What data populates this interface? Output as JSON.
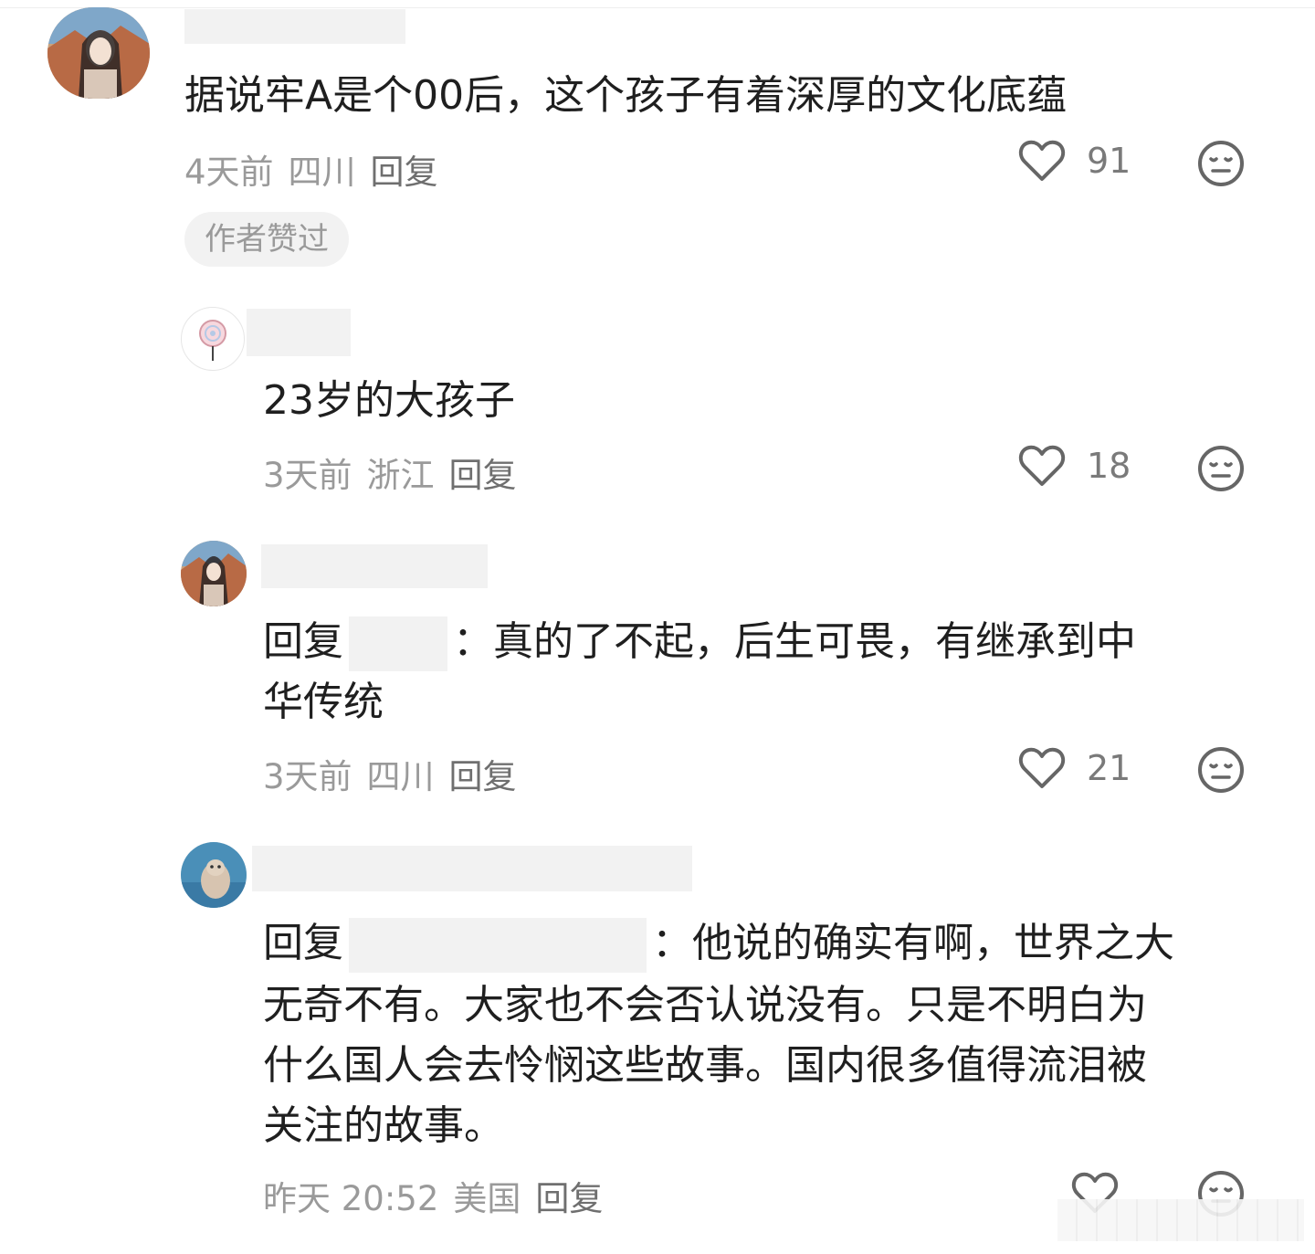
{
  "comments": [
    {
      "content": "据说牢A是个00后，这个孩子有着深厚的文化底蕴",
      "time": "4天前",
      "location": "四川",
      "reply_label": "回复",
      "likes": "91",
      "badge": "作者赞过"
    },
    {
      "content": "23岁的大孩子",
      "time": "3天前",
      "location": "浙江",
      "reply_label": "回复",
      "likes": "18"
    },
    {
      "reply_prefix": "回复",
      "content_line1": "：真的了不起，后生可畏，有继承到中",
      "content_line2": "华传统",
      "time": "3天前",
      "location": "四川",
      "reply_label": "回复",
      "likes": "21"
    },
    {
      "reply_prefix": "回复",
      "content_line1": "：他说的确实有啊，世界之大",
      "content_line2": "无奇不有。大家也不会否认说没有。只是不明白为",
      "content_line3": "什么国人会去怜悯这些故事。国内很多值得流泪被",
      "content_line4": "关注的故事。",
      "time": "昨天 20:52",
      "location": "美国",
      "reply_label": "回复"
    }
  ],
  "icons": {
    "like": "heart-outline-icon",
    "dislike": "neutral-face-icon"
  },
  "colors": {
    "text": "#1f1f1f",
    "meta": "#9a9a9a",
    "icon": "#666666",
    "block": "#f2f2f2"
  }
}
